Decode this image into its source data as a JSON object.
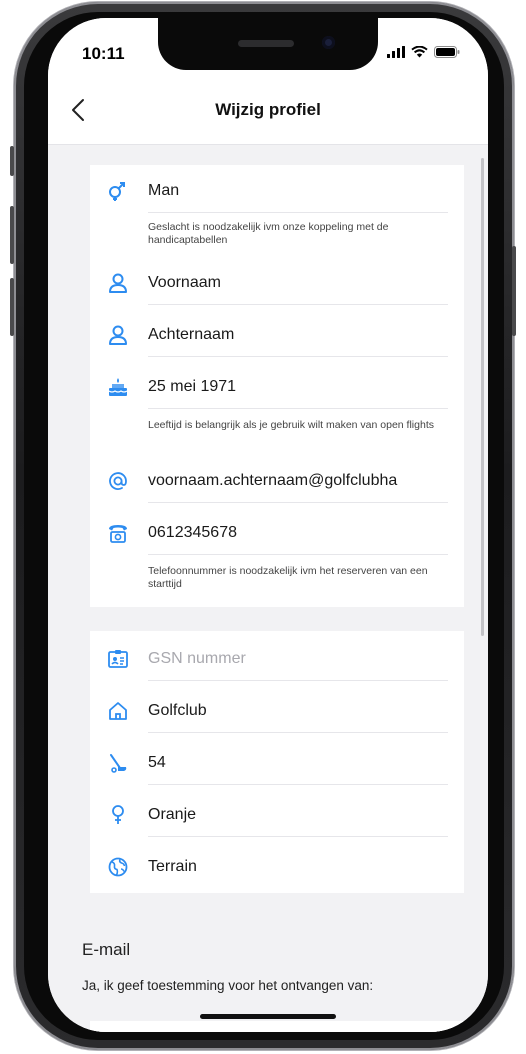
{
  "status_bar": {
    "time": "10:11"
  },
  "nav": {
    "title": "Wijzig profiel"
  },
  "personal": {
    "gender": {
      "icon": "gender-icon",
      "value": "Man"
    },
    "gender_hint": "Geslacht is noodzakelijk ivm onze koppeling met de handicaptabellen",
    "first_name": {
      "icon": "user-icon",
      "value": "Voornaam"
    },
    "last_name": {
      "icon": "user-icon",
      "value": "Achternaam"
    },
    "birthday": {
      "icon": "cake-icon",
      "value": "25 mei 1971"
    },
    "birthday_hint": "Leeftijd is belangrijk als je gebruik wilt maken van open flights",
    "email": {
      "icon": "at-icon",
      "value": "voornaam.achternaam@golfclubha"
    },
    "phone": {
      "icon": "phone-icon",
      "value": "0612345678"
    },
    "phone_hint": "Telefoonnummer is noodzakelijk ivm het reserveren van een starttijd"
  },
  "golf": {
    "gsn": {
      "icon": "id-card-icon",
      "placeholder": "GSN nummer"
    },
    "club": {
      "icon": "home-icon",
      "value": "Golfclub"
    },
    "handicap": {
      "icon": "golf-club-icon",
      "value": "54"
    },
    "tee": {
      "icon": "tee-pin-icon",
      "value": "Oranje"
    },
    "terrain": {
      "icon": "globe-icon",
      "value": "Terrain"
    }
  },
  "email_section": {
    "title": "E-mail",
    "consent": "Ja, ik geef toestemming voor het ontvangen van:"
  },
  "colors": {
    "accent": "#2d8cf0",
    "background": "#f2f2f4",
    "card": "#ffffff"
  }
}
